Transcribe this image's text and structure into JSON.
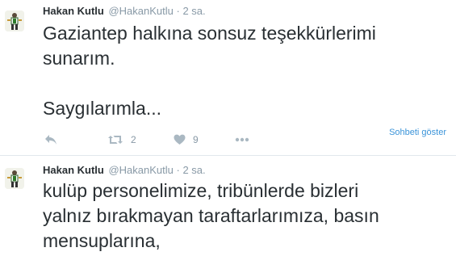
{
  "tweets": [
    {
      "name": "Hakan Kutlu",
      "handle": "@HakanKutlu",
      "separator": "·",
      "time": "2 sa.",
      "text": "Gaziantep halkına sonsuz teşekkürlerimi\nsunarım.\n\nSaygılarımla...",
      "actions": {
        "retweet_count": "2",
        "like_count": "9",
        "conversation_link": "Sohbeti göster"
      }
    },
    {
      "name": "Hakan Kutlu",
      "handle": "@HakanKutlu",
      "separator": "·",
      "time": "2 sa.",
      "text": "kulüp personelimize, tribünlerde bizleri\nyalnız bırakmayan taraftarlarımıza, basın\nmensuplarına,"
    }
  ],
  "icons": [
    "avatar",
    "reply-icon",
    "retweet-icon",
    "like-icon",
    "more-icon"
  ],
  "colors": {
    "text": "#292f33",
    "muted": "#8899a6",
    "icon": "#aab8c2",
    "link": "#3b94d9",
    "divider": "#e1e8ed"
  }
}
